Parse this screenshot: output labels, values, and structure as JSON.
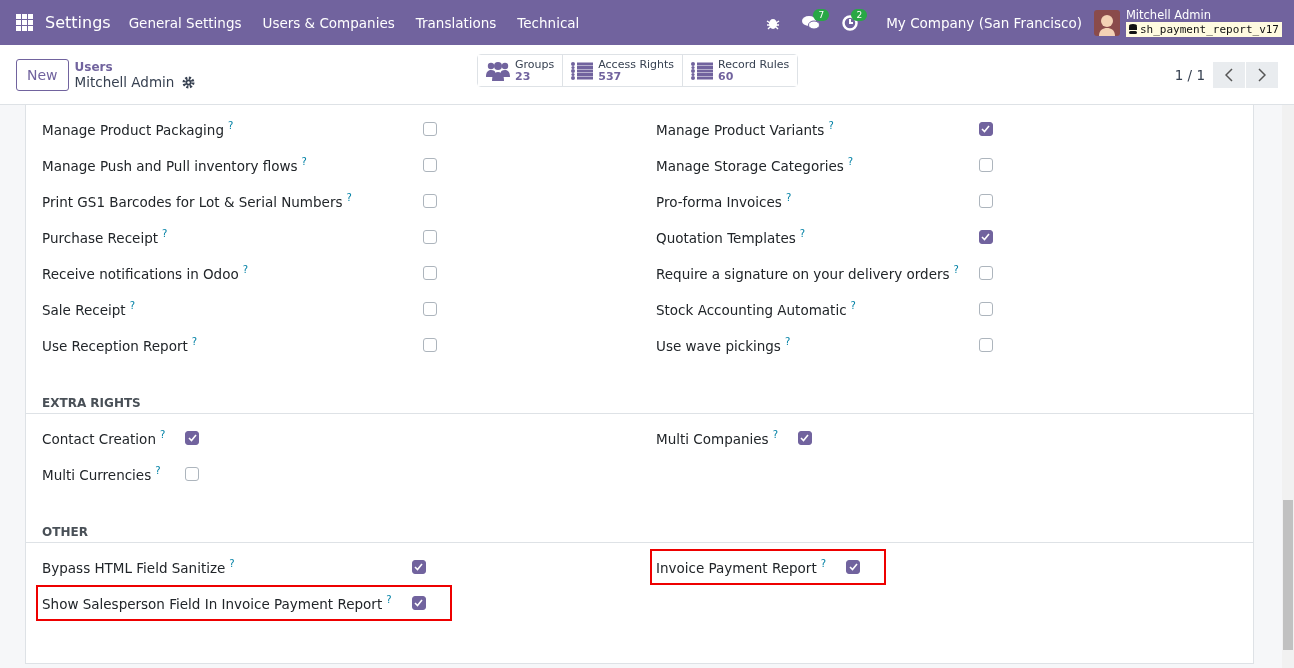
{
  "navbar": {
    "app": "Settings",
    "menu": [
      "General Settings",
      "Users & Companies",
      "Translations",
      "Technical"
    ],
    "messages_badge": "7",
    "activities_badge": "2",
    "company": "My Company (San Francisco)",
    "user": "Mitchell Admin",
    "database": "sh_payment_report_v17"
  },
  "control_panel": {
    "new_button": "New",
    "breadcrumb": "Users",
    "record": "Mitchell Admin",
    "stats": [
      {
        "kind": "groups",
        "label": "Groups",
        "value": "23"
      },
      {
        "kind": "list",
        "label": "Access Rights",
        "value": "537"
      },
      {
        "kind": "list",
        "label": "Record Rules",
        "value": "60"
      }
    ],
    "pager": "1 / 1"
  },
  "sections": [
    {
      "columns": [
        [
          {
            "label": "Manage Product Packaging",
            "checked": false,
            "highlighted": false
          },
          {
            "label": "Manage Push and Pull inventory flows",
            "checked": false,
            "highlighted": false
          },
          {
            "label": "Print GS1 Barcodes for Lot & Serial Numbers",
            "checked": false,
            "highlighted": false
          },
          {
            "label": "Purchase Receipt",
            "checked": false,
            "highlighted": false
          },
          {
            "label": "Receive notifications in Odoo",
            "checked": false,
            "highlighted": false
          },
          {
            "label": "Sale Receipt",
            "checked": false,
            "highlighted": false
          },
          {
            "label": "Use Reception Report",
            "checked": false,
            "highlighted": false
          }
        ],
        [
          {
            "label": "Manage Product Variants",
            "checked": true,
            "highlighted": false
          },
          {
            "label": "Manage Storage Categories",
            "checked": false,
            "highlighted": false
          },
          {
            "label": "Pro-forma Invoices",
            "checked": false,
            "highlighted": false
          },
          {
            "label": "Quotation Templates",
            "checked": true,
            "highlighted": false
          },
          {
            "label": "Require a signature on your delivery orders",
            "checked": false,
            "highlighted": false
          },
          {
            "label": "Stock Accounting Automatic",
            "checked": false,
            "highlighted": false
          },
          {
            "label": "Use wave pickings",
            "checked": false,
            "highlighted": false
          }
        ]
      ]
    },
    {
      "title": "EXTRA RIGHTS",
      "columns": [
        [
          {
            "label": "Contact Creation",
            "checked": true,
            "highlighted": false
          },
          {
            "label": "Multi Currencies",
            "checked": false,
            "highlighted": false
          }
        ],
        [
          {
            "label": "Multi Companies",
            "checked": true,
            "highlighted": false
          }
        ]
      ]
    },
    {
      "title": "OTHER",
      "columns": [
        [
          {
            "label": "Bypass HTML Field Sanitize",
            "checked": true,
            "highlighted": false
          },
          {
            "label": "Show Salesperson Field In Invoice Payment Report",
            "checked": true,
            "highlighted": true
          }
        ],
        [
          {
            "label": "Invoice Payment Report",
            "checked": true,
            "highlighted": true
          }
        ]
      ]
    }
  ],
  "help_mark": "?"
}
